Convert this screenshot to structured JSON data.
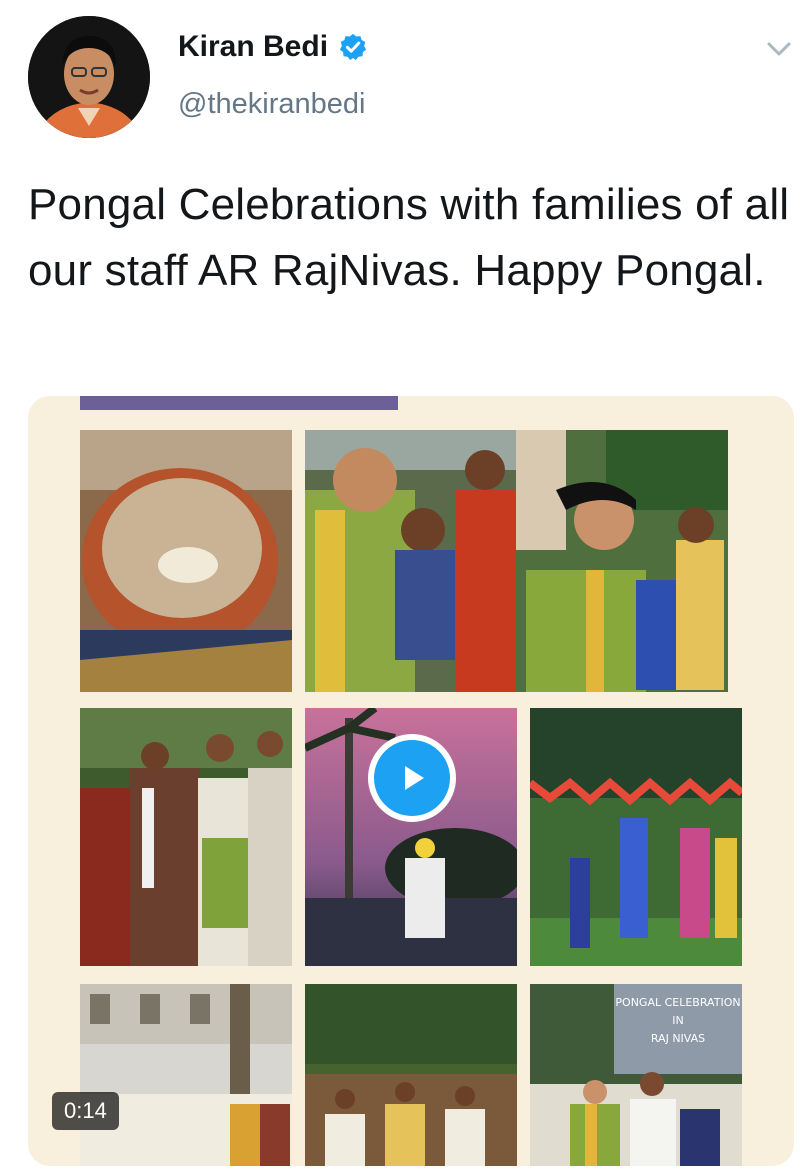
{
  "author": {
    "name": "Kiran Bedi",
    "handle": "@thekiranbedi",
    "verified": true,
    "verified_color": "#1da1f2"
  },
  "tweet": {
    "text": "Pongal Celebrations with families of all our staff AR RajNivas. Happy Pongal."
  },
  "media": {
    "type": "video",
    "duration": "0:14",
    "background_color": "#f8efdc",
    "overlay_texts": [
      "PONGAL CELEBRATION",
      "IN",
      "RAJ NIVAS"
    ]
  },
  "icons": {
    "verified": "verified-badge-icon",
    "caret": "chevron-down-icon",
    "play": "play-icon"
  }
}
